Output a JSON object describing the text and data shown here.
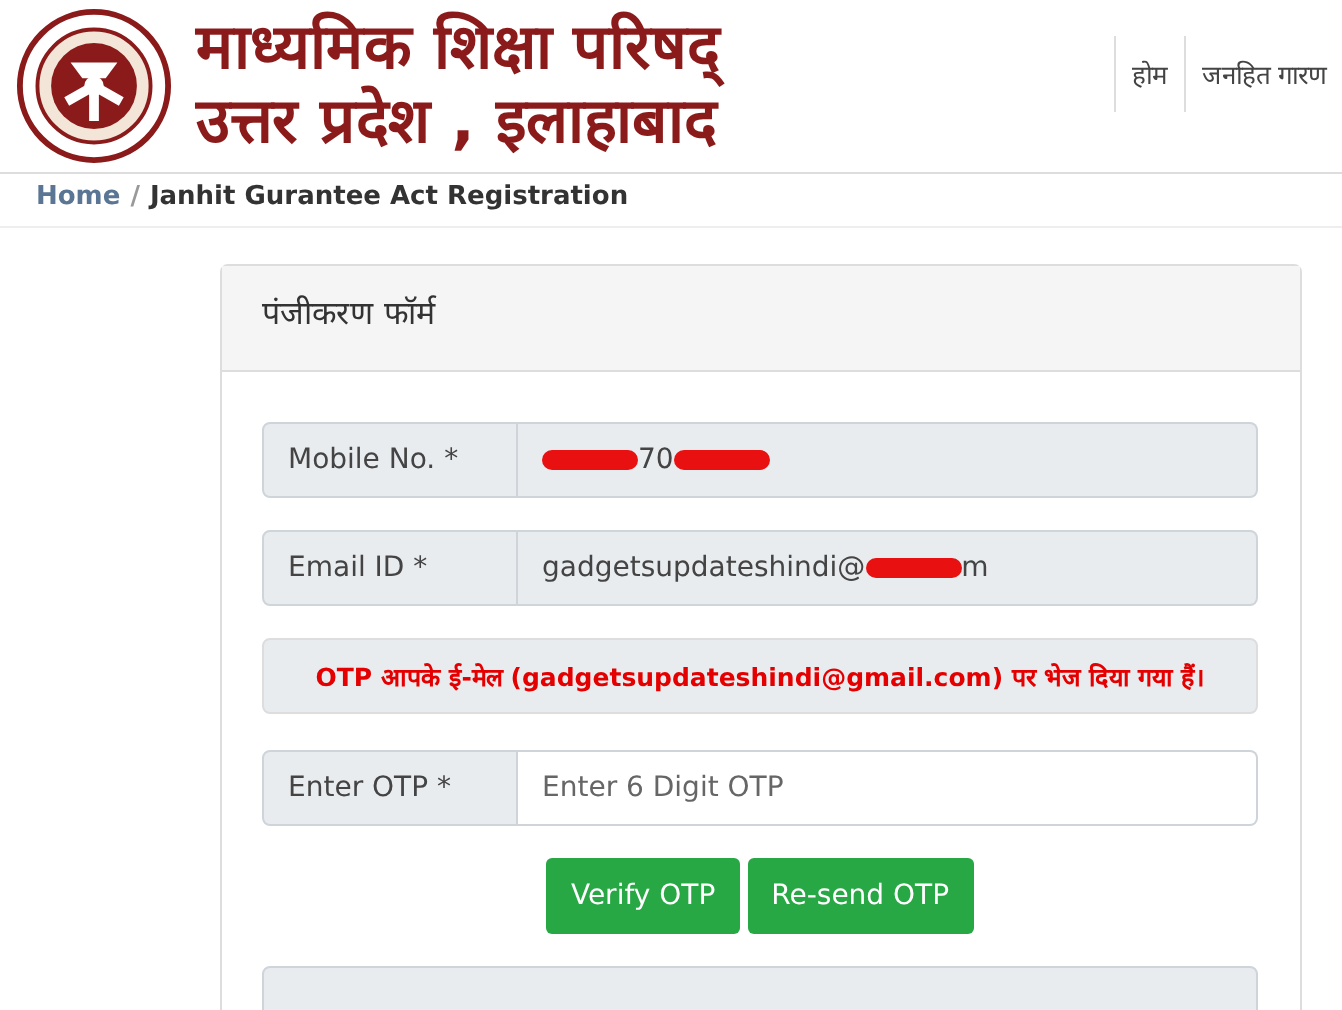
{
  "header": {
    "title_lines": [
      "माध्यमिक शिक्षा परिषद्",
      "उत्तर प्रदेश , इलाहाबाद"
    ],
    "nav": [
      "होम",
      "जनहित गारण"
    ]
  },
  "breadcrumb": {
    "home": "Home",
    "separator": "/",
    "current": "Janhit Gurantee Act Registration"
  },
  "form": {
    "title": "पंजीकरण फॉर्म",
    "fields": [
      {
        "label": "Mobile No. *",
        "readonly": true,
        "parts": [
          {
            "kind": "redacted"
          },
          {
            "kind": "text",
            "text": "70"
          },
          {
            "kind": "redacted"
          }
        ]
      },
      {
        "label": "Email ID *",
        "readonly": true,
        "parts": [
          {
            "kind": "text",
            "text": "gadgetsupdateshindi@"
          },
          {
            "kind": "redacted"
          },
          {
            "kind": "text",
            "text": "m"
          }
        ]
      }
    ],
    "notice": "OTP आपके ई-मेल (gadgetsupdateshindi@gmail.com) पर भेज दिया गया हैं।",
    "otp": {
      "label": "Enter OTP *",
      "placeholder": "Enter 6 Digit OTP"
    },
    "buttons": [
      "Verify OTP",
      "Re-send OTP"
    ]
  }
}
